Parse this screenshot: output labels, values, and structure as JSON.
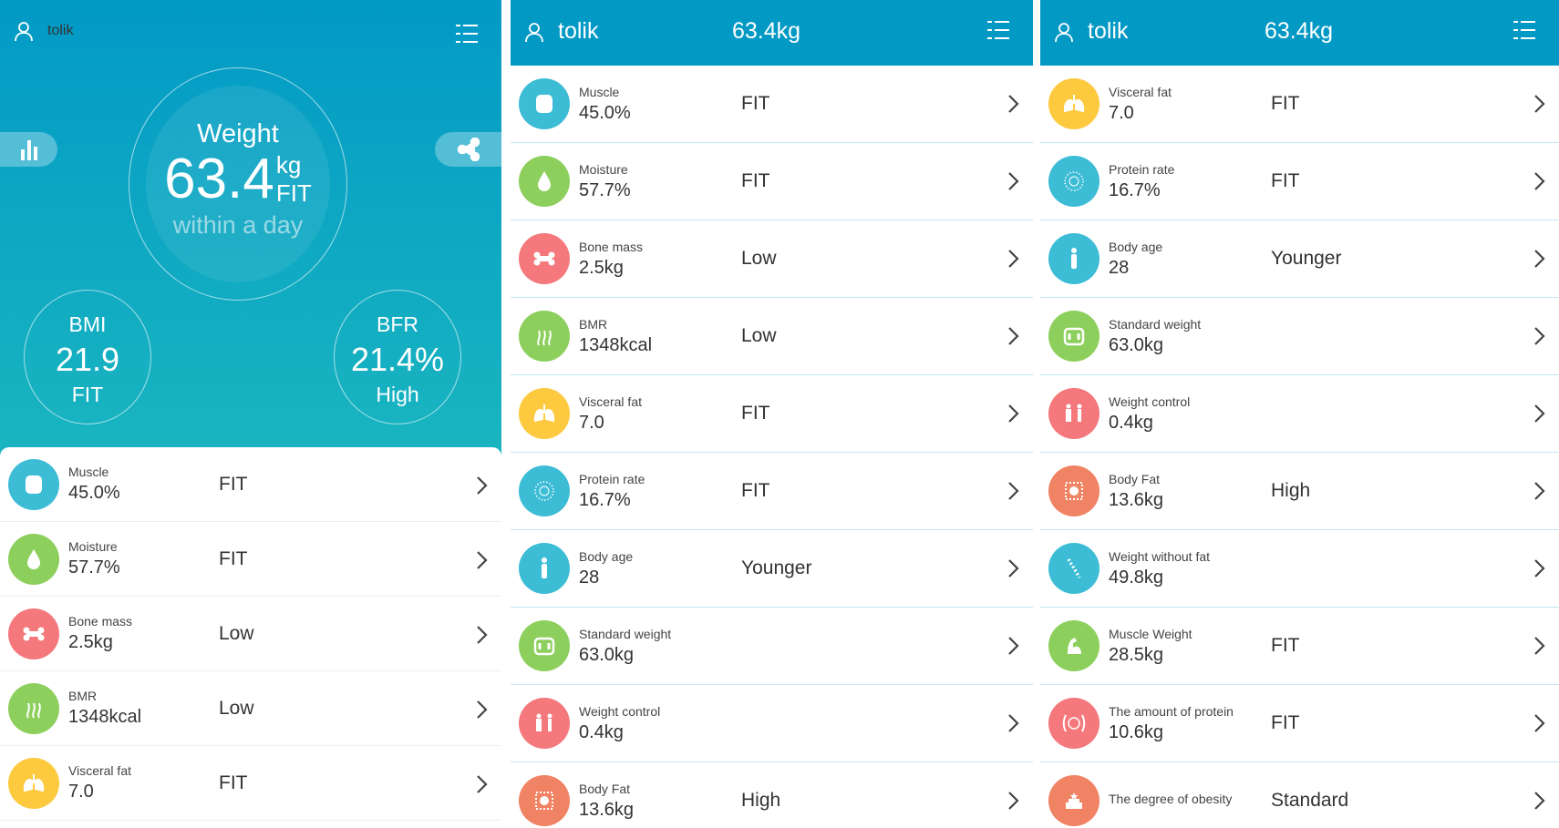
{
  "user": "tolik",
  "header_weight": "63.4kg",
  "hero": {
    "title": "Weight",
    "value": "63.4",
    "unit": "kg",
    "status": "FIT",
    "subtitle": "within a day",
    "bmi": {
      "label": "BMI",
      "value": "21.9",
      "status": "FIT"
    },
    "bfr": {
      "label": "BFR",
      "value": "21.4%",
      "status": "High"
    }
  },
  "colors": {
    "header": "#0399c5",
    "blue": "#3dbcd6",
    "green": "#8dcf5c",
    "red": "#f4787c",
    "yellow": "#fdc93f",
    "orange": "#f08363"
  },
  "metrics": [
    {
      "name": "Muscle",
      "value": "45.0%",
      "status": "FIT",
      "color": "blue",
      "icon": "muscle-icon"
    },
    {
      "name": "Moisture",
      "value": "57.7%",
      "status": "FIT",
      "color": "green",
      "icon": "water-drop-icon"
    },
    {
      "name": "Bone mass",
      "value": "2.5kg",
      "status": "Low",
      "color": "red",
      "icon": "bone-icon"
    },
    {
      "name": "BMR",
      "value": "1348kcal",
      "status": "Low",
      "color": "green",
      "icon": "heat-waves-icon"
    },
    {
      "name": "Visceral fat",
      "value": "7.0",
      "status": "FIT",
      "color": "yellow",
      "icon": "lungs-icon"
    },
    {
      "name": "Protein rate",
      "value": "16.7%",
      "status": "FIT",
      "color": "blue",
      "icon": "protein-icon"
    },
    {
      "name": "Body age",
      "value": "28",
      "status": "Younger",
      "color": "blue",
      "icon": "body-icon"
    },
    {
      "name": "Standard weight",
      "value": "63.0kg",
      "status": "",
      "color": "green",
      "icon": "scale-icon"
    },
    {
      "name": "Weight control",
      "value": "0.4kg",
      "status": "",
      "color": "red",
      "icon": "weight-control-icon"
    },
    {
      "name": "Body Fat",
      "value": "13.6kg",
      "status": "High",
      "color": "orange",
      "icon": "body-fat-icon"
    },
    {
      "name": "Weight without fat",
      "value": "49.8kg",
      "status": "",
      "color": "blue",
      "icon": "spine-icon"
    },
    {
      "name": "Muscle Weight",
      "value": "28.5kg",
      "status": "FIT",
      "color": "green",
      "icon": "bicep-icon"
    },
    {
      "name": "The amount of protein",
      "value": "10.6kg",
      "status": "FIT",
      "color": "red",
      "icon": "protein-amount-icon"
    },
    {
      "name": "The degree of obesity",
      "value": "",
      "status": "Standard",
      "color": "orange",
      "icon": "obesity-degree-icon"
    }
  ]
}
